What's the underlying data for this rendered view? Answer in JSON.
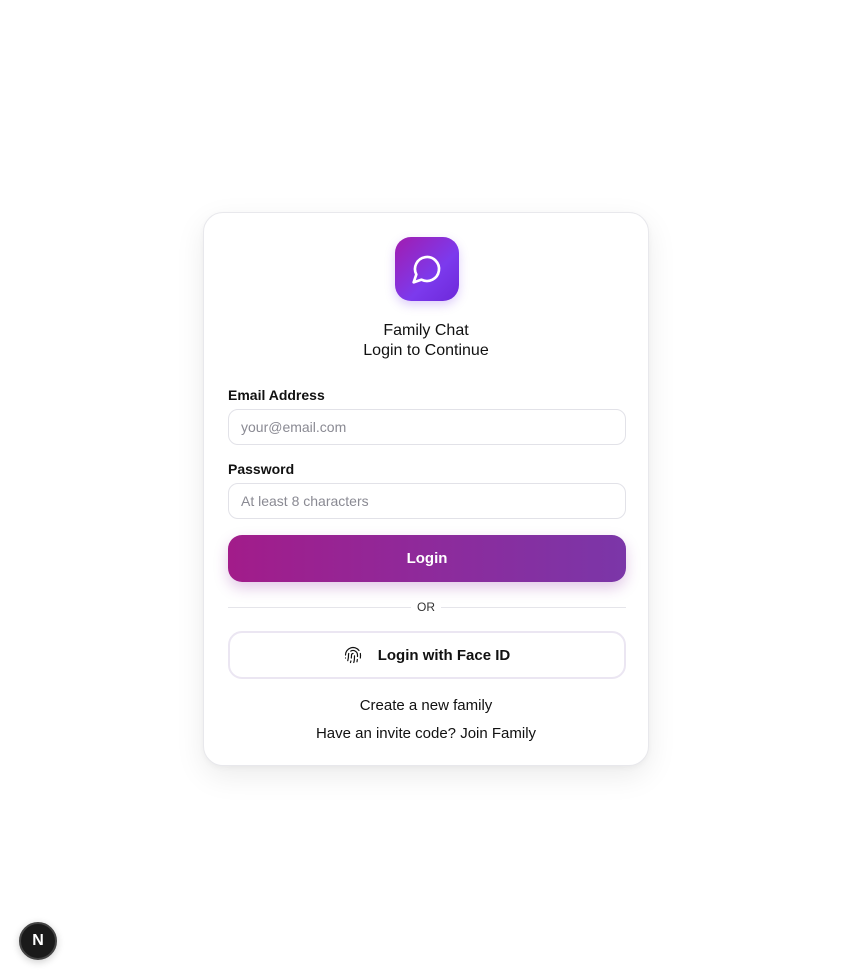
{
  "app": {
    "title": "Family Chat",
    "subtitle": "Login to Continue",
    "icon": "chat-bubble-icon",
    "accent_gradient": [
      "#a21caf",
      "#7c3aed"
    ]
  },
  "form": {
    "email_label": "Email Address",
    "email_placeholder": "your@email.com",
    "email_value": "",
    "password_label": "Password",
    "password_placeholder": "At least 8 characters",
    "password_value": "",
    "login_label": "Login",
    "or_label": "OR",
    "faceid_label": "Login with Face ID",
    "faceid_icon": "fingerprint-icon"
  },
  "links": {
    "create_family": "Create a new family",
    "join_family": "Have an invite code? Join Family"
  },
  "dev_badge": {
    "label": "N",
    "icon": "nextjs-logo-icon"
  }
}
